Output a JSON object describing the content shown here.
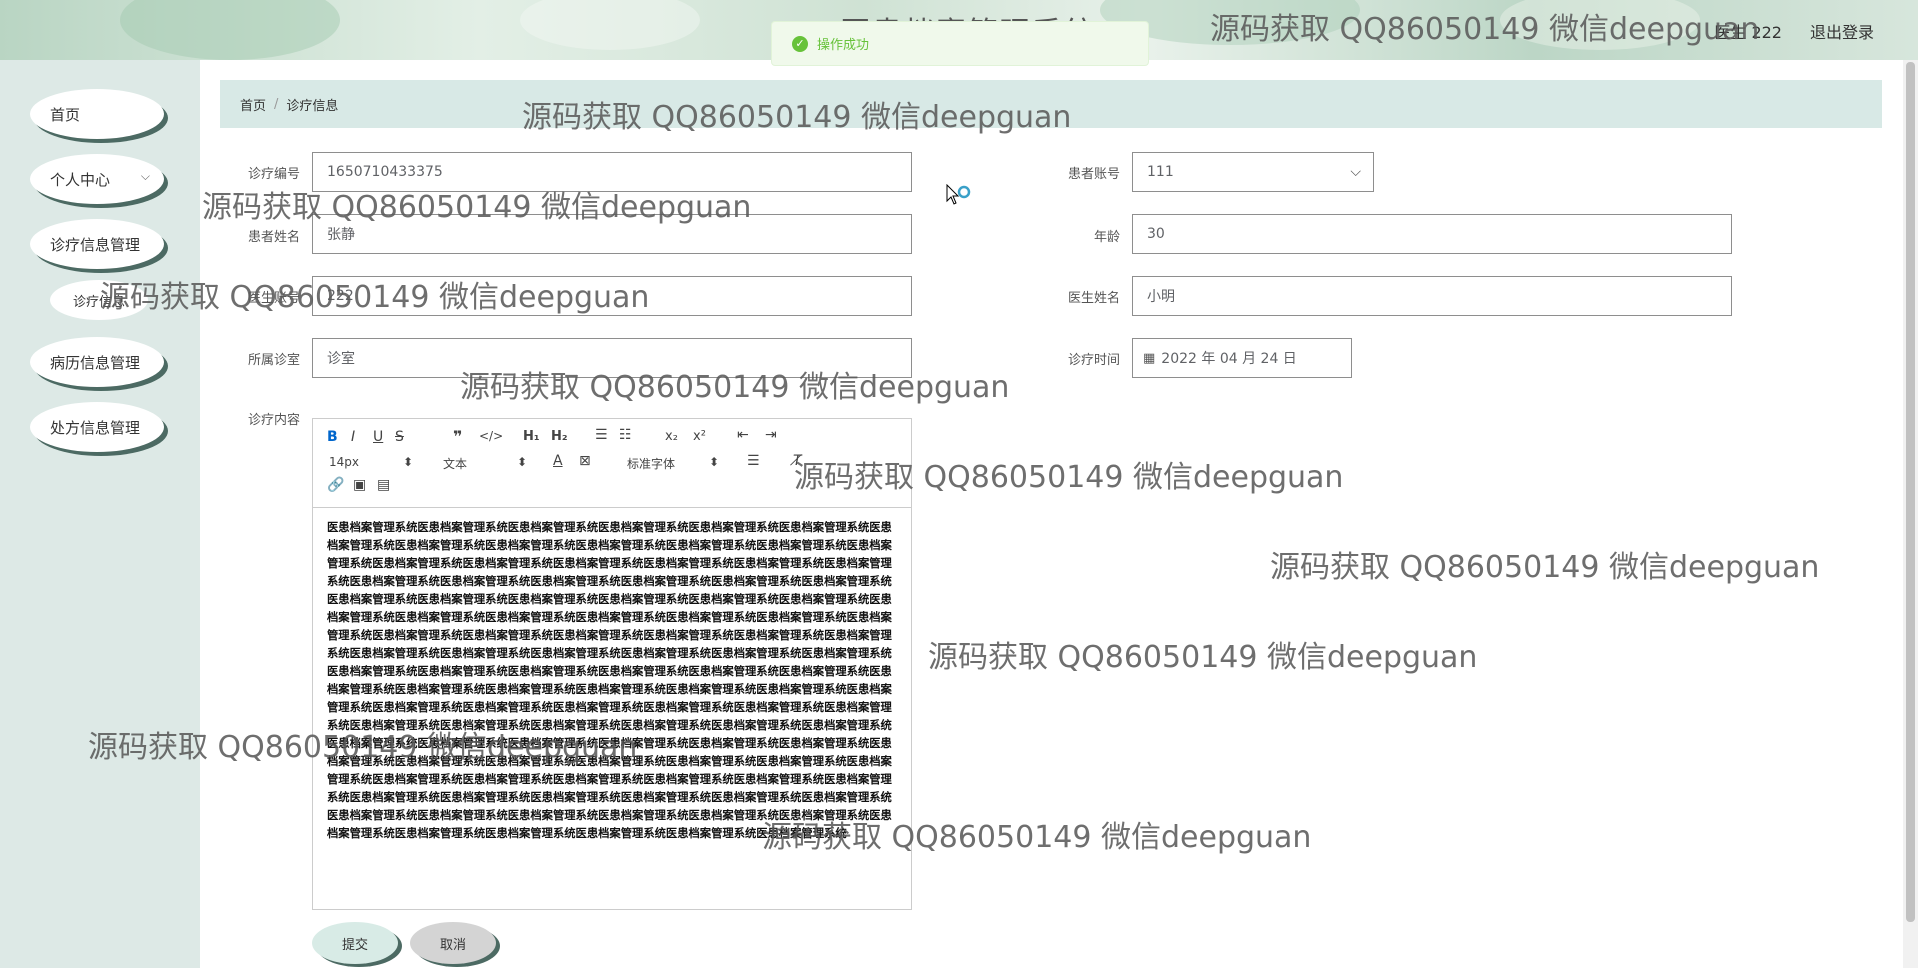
{
  "header": {
    "title": "医患档案管理系统",
    "user": "医生 222",
    "logout": "退出登录"
  },
  "toast": {
    "message": "操作成功",
    "icon": "check-circle-icon"
  },
  "sidebar": {
    "items": [
      {
        "label": "首页"
      },
      {
        "label": "个人中心"
      },
      {
        "label": "诊疗信息管理"
      },
      {
        "label": "诊疗信息"
      },
      {
        "label": "病历信息管理"
      },
      {
        "label": "处方信息管理"
      }
    ]
  },
  "breadcrumb": {
    "home": "首页",
    "separator": "/",
    "current": "诊疗信息"
  },
  "form": {
    "code": {
      "label": "诊疗编号",
      "value": "1650710433375"
    },
    "patient_account": {
      "label": "患者账号",
      "value": "111"
    },
    "patient_name": {
      "label": "患者姓名",
      "value": "张静"
    },
    "age": {
      "label": "年龄",
      "value": "30"
    },
    "doctor_account": {
      "label": "医生账号",
      "value": "222"
    },
    "doctor_name": {
      "label": "医生姓名",
      "value": "小明"
    },
    "clinic": {
      "label": "所属诊室",
      "value": "诊室"
    },
    "time": {
      "label": "诊疗时间",
      "value": "2022 年 04 月 24 日"
    },
    "content": {
      "label": "诊疗内容"
    }
  },
  "editor": {
    "font_size": "14px",
    "header_select": "文本",
    "font_family": "标准字体",
    "text_unit": "医患档案管理系统",
    "text_repeats": 112
  },
  "buttons": {
    "submit": "提交",
    "cancel": "取消"
  },
  "watermark": "源码获取 QQ86050149 微信deepguan",
  "colors": {
    "sidebar_bg": "#dde9e6",
    "breadcrumb_bg": "#d8e9e6",
    "menu_shadow": "#4c6a63",
    "success": "#67c23a"
  }
}
